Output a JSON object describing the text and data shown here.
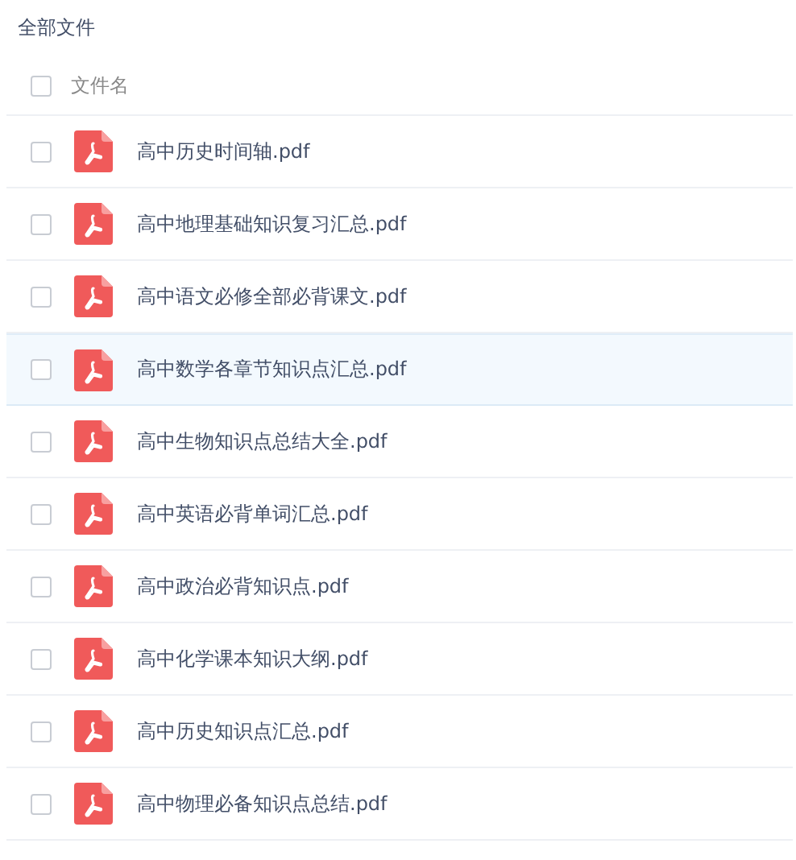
{
  "title": "全部文件",
  "header": {
    "label": "文件名",
    "checked": false
  },
  "files": [
    {
      "name": "高中历史时间轴.pdf",
      "checked": false,
      "highlighted": false
    },
    {
      "name": "高中地理基础知识复习汇总.pdf",
      "checked": false,
      "highlighted": false
    },
    {
      "name": "高中语文必修全部必背课文.pdf",
      "checked": false,
      "highlighted": false
    },
    {
      "name": "高中数学各章节知识点汇总.pdf",
      "checked": false,
      "highlighted": true
    },
    {
      "name": "高中生物知识点总结大全.pdf",
      "checked": false,
      "highlighted": false
    },
    {
      "name": "高中英语必背单词汇总.pdf",
      "checked": false,
      "highlighted": false
    },
    {
      "name": "高中政治必背知识点.pdf",
      "checked": false,
      "highlighted": false
    },
    {
      "name": "高中化学课本知识大纲.pdf",
      "checked": false,
      "highlighted": false
    },
    {
      "name": "高中历史知识点汇总.pdf",
      "checked": false,
      "highlighted": false
    },
    {
      "name": "高中物理必备知识点总结.pdf",
      "checked": false,
      "highlighted": false
    }
  ]
}
